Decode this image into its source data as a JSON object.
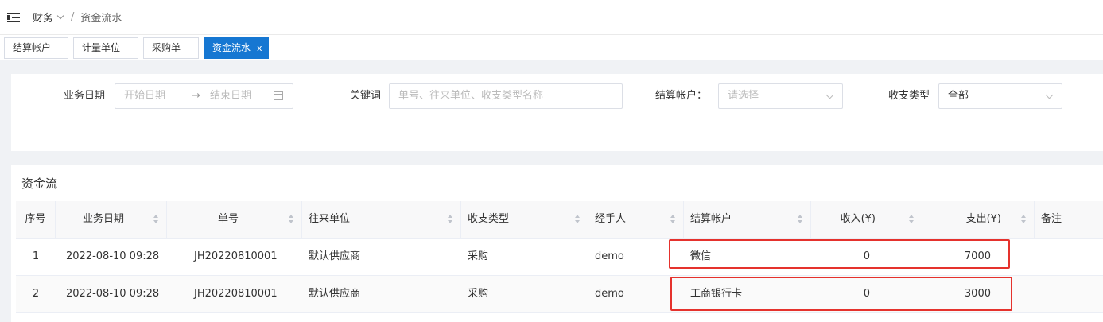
{
  "breadcrumb": {
    "parent": "财务",
    "current": "资金流水"
  },
  "tabs": [
    {
      "label": "结算帐户",
      "active": false
    },
    {
      "label": "计量单位",
      "active": false
    },
    {
      "label": "采购单",
      "active": false
    },
    {
      "label": "资金流水",
      "active": true,
      "close": "x"
    }
  ],
  "filters": {
    "date_label": "业务日期",
    "date_start_placeholder": "开始日期",
    "date_arrow": "→",
    "date_end_placeholder": "结束日期",
    "keyword_label": "关键词",
    "keyword_placeholder": "单号、往来单位、收支类型名称",
    "account_label": "结算帐户：",
    "account_placeholder": "请选择",
    "type_label": "收支类型",
    "type_value": "全部"
  },
  "table": {
    "title": "资金流",
    "columns": [
      "序号",
      "业务日期",
      "单号",
      "往来单位",
      "收支类型",
      "经手人",
      "结算帐户",
      "收入(¥)",
      "支出(¥)",
      "备注"
    ],
    "rows": [
      {
        "index": "1",
        "date": "2022-08-10 09:28",
        "no": "JH20220810001",
        "partner": "默认供应商",
        "type": "采购",
        "handler": "demo",
        "account": "微信",
        "income": "0",
        "expense": "7000",
        "remark": ""
      },
      {
        "index": "2",
        "date": "2022-08-10 09:28",
        "no": "JH20220810001",
        "partner": "默认供应商",
        "type": "采购",
        "handler": "demo",
        "account": "工商银行卡",
        "income": "0",
        "expense": "3000",
        "remark": ""
      }
    ]
  },
  "colors": {
    "accent": "#1677d2",
    "highlight": "#e5322d"
  }
}
